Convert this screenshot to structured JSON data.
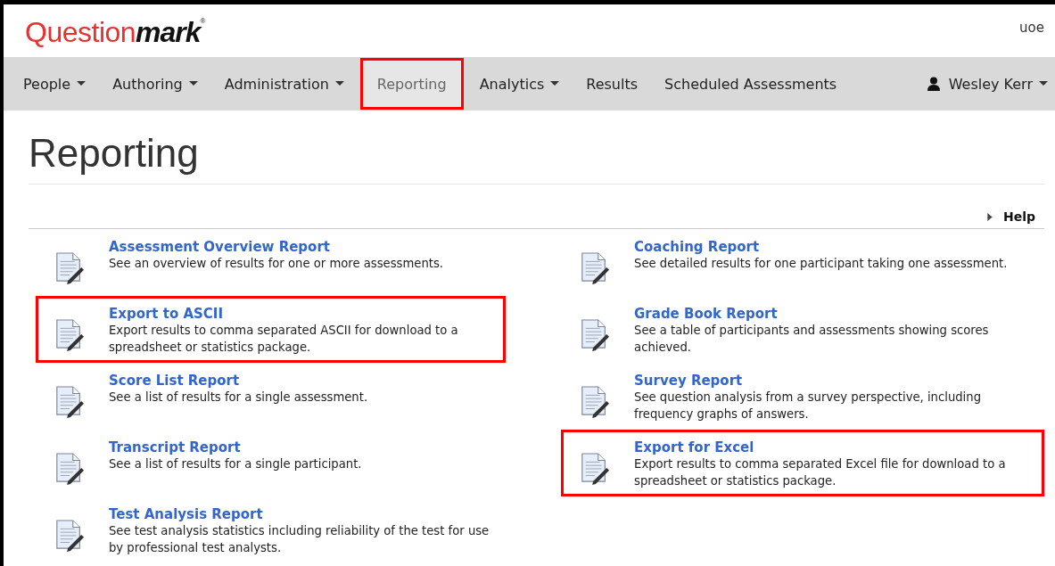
{
  "logo": {
    "part_1": "Question",
    "part_2": "mark",
    "mark": "®"
  },
  "account": "uoe",
  "nav": [
    {
      "label": "People",
      "has_caret": true,
      "selected": false,
      "highlighted": false
    },
    {
      "label": "Authoring",
      "has_caret": true,
      "selected": false,
      "highlighted": false
    },
    {
      "label": "Administration",
      "has_caret": true,
      "selected": false,
      "highlighted": false
    },
    {
      "label": "Reporting",
      "has_caret": false,
      "selected": true,
      "highlighted": true
    },
    {
      "label": "Analytics",
      "has_caret": true,
      "selected": false,
      "highlighted": false
    },
    {
      "label": "Results",
      "has_caret": false,
      "selected": false,
      "highlighted": false
    },
    {
      "label": "Scheduled Assessments",
      "has_caret": false,
      "selected": false,
      "highlighted": false
    }
  ],
  "user": {
    "name": "Wesley Kerr",
    "has_caret": true
  },
  "heading": "Reporting",
  "help": "Help",
  "reports_left": [
    {
      "title": "Assessment Overview Report",
      "description": "See an overview of results for one or more assessments.",
      "highlighted": false
    },
    {
      "title": "Export to ASCII",
      "description": "Export results to comma separated ASCII for download to a spreadsheet or statistics package.",
      "highlighted": true
    },
    {
      "title": "Score List Report",
      "description": "See a list of results for a single assessment.",
      "highlighted": false
    },
    {
      "title": "Transcript Report",
      "description": "See a list of results for a single participant.",
      "highlighted": false
    },
    {
      "title": "Test Analysis Report",
      "description": "See test analysis statistics including reliability of the test for use by professional test analysts.",
      "highlighted": false
    }
  ],
  "reports_right": [
    {
      "title": "Coaching Report",
      "description": "See detailed results for one participant taking one assessment.",
      "highlighted": false
    },
    {
      "title": "Grade Book Report",
      "description": "See a table of participants and assessments showing scores achieved.",
      "highlighted": false
    },
    {
      "title": "Survey Report",
      "description": "See question analysis from a survey perspective, including frequency graphs of answers.",
      "highlighted": false
    },
    {
      "title": "Export for Excel",
      "description": "Export results to comma separated Excel file for download to a spreadsheet or statistics package.",
      "highlighted": true
    }
  ]
}
